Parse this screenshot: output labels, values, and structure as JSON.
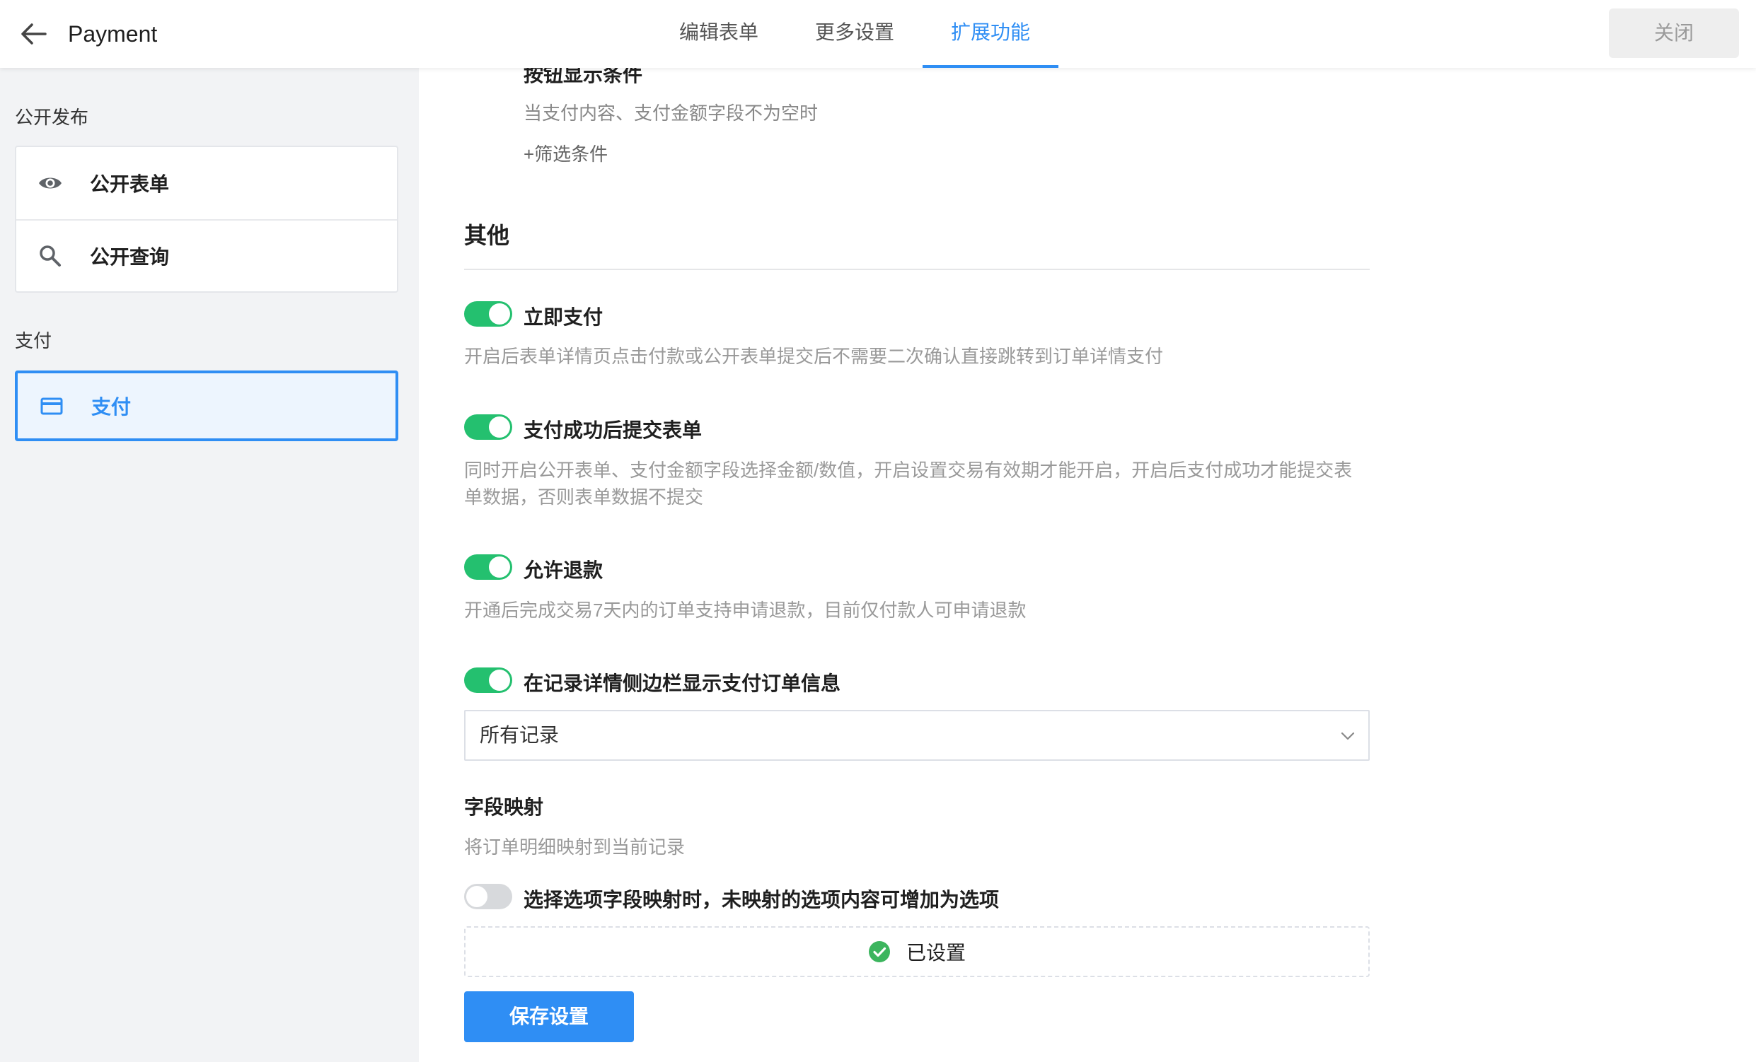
{
  "header": {
    "title": "Payment",
    "tabs": [
      {
        "label": "编辑表单"
      },
      {
        "label": "更多设置"
      },
      {
        "label": "扩展功能"
      }
    ],
    "close_label": "关闭"
  },
  "sidebar": {
    "groups": [
      {
        "title": "公开发布",
        "items": [
          {
            "label": "公开表单",
            "icon": "eye-icon"
          },
          {
            "label": "公开查询",
            "icon": "search-icon"
          }
        ]
      },
      {
        "title": "支付",
        "items": [
          {
            "label": "支付",
            "icon": "credit-card-icon"
          }
        ]
      }
    ]
  },
  "main": {
    "condition": {
      "title": "按钮显示条件",
      "text": "当支付内容、支付金额字段不为空时",
      "add_filter": "+筛选条件"
    },
    "other": {
      "title": "其他",
      "options": [
        {
          "label": "立即支付",
          "enabled": true,
          "desc": "开启后表单详情页点击付款或公开表单提交后不需要二次确认直接跳转到订单详情支付"
        },
        {
          "label": "支付成功后提交表单",
          "enabled": true,
          "desc_line1": "同时开启公开表单、支付金额字段选择金额/数值，开启设置交易有效期才能开启，开启后支付成功才能提交表",
          "desc_line2": "单数据，否则表单数据不提交"
        },
        {
          "label": "允许退款",
          "enabled": true,
          "desc": "开通后完成交易7天内的订单支持申请退款，目前仅付款人可申请退款"
        },
        {
          "label": "在记录详情侧边栏显示支付订单信息",
          "enabled": true
        }
      ],
      "record_scope_select": {
        "value": "所有记录"
      }
    },
    "mapping": {
      "title": "字段映射",
      "desc": "将订单明细映射到当前记录",
      "option_label": "选择选项字段映射时，未映射的选项内容可增加为选项",
      "option_enabled": false,
      "configured_label": "已设置"
    },
    "save_label": "保存设置"
  },
  "colors": {
    "accent": "#2f8ef4",
    "switch_on": "#24c06f",
    "switch_off": "#d7d9dc",
    "check": "#3cb55e"
  }
}
